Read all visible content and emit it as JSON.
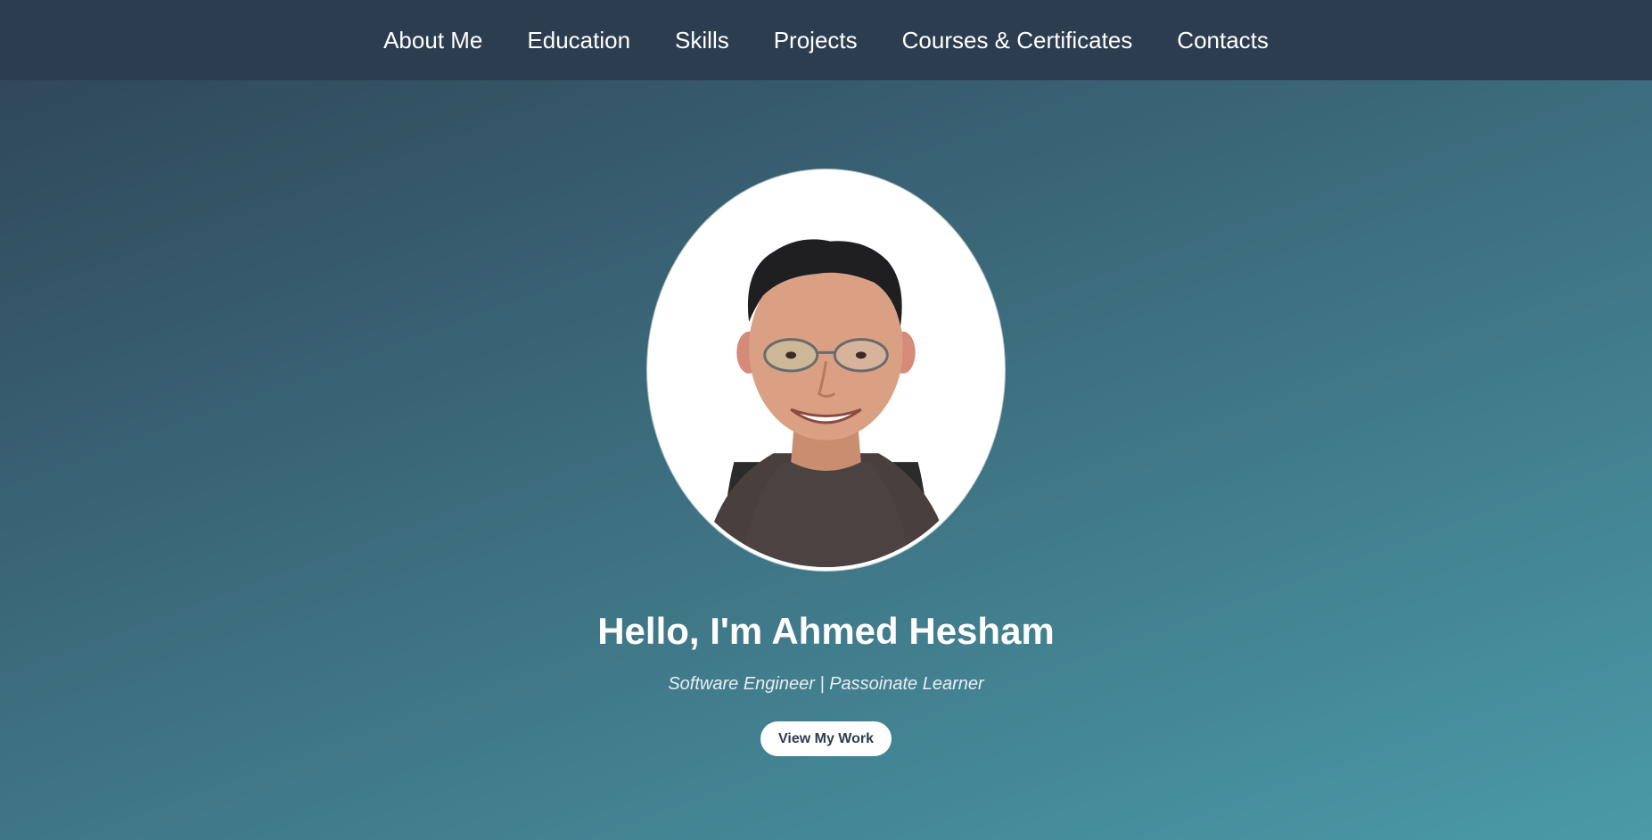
{
  "nav": {
    "items": [
      {
        "label": "About Me"
      },
      {
        "label": "Education"
      },
      {
        "label": "Skills"
      },
      {
        "label": "Projects"
      },
      {
        "label": "Courses & Certificates"
      },
      {
        "label": "Contacts"
      }
    ]
  },
  "hero": {
    "avatar_alt": "Ahmed Hesham",
    "title": "Hello, I'm Ahmed Hesham",
    "subtitle": "Software Engineer | Passoinate Learner",
    "cta_label": "View My Work"
  },
  "colors": {
    "navbar_bg": "#2d3d50",
    "gradient_start": "#2e4356",
    "gradient_end": "#4a9aa8",
    "text": "#ffffff",
    "button_bg": "#ffffff",
    "button_text": "#2d3d50"
  }
}
